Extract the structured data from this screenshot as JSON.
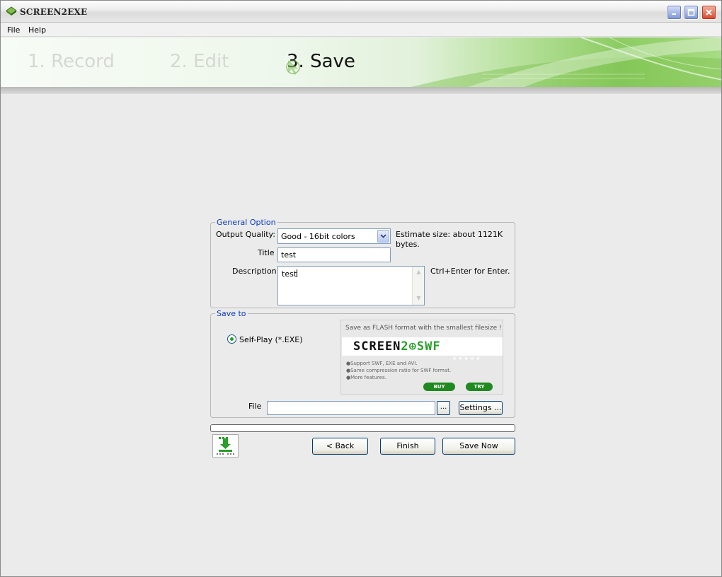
{
  "window": {
    "title": "SCREEN2EXE"
  },
  "menu": {
    "file": "File",
    "help": "Help"
  },
  "steps": {
    "record": "1. Record",
    "edit": "2. Edit",
    "save": "3. Save",
    "active": "save"
  },
  "general_option": {
    "legend": "General Option",
    "output_quality_label": "Output Quality:",
    "output_quality_value": "Good - 16bit colors",
    "estimate_line1": "Estimate size: about 1121K",
    "estimate_line2": "bytes.",
    "title_label": "Title",
    "title_value": "test",
    "description_label": "Description",
    "description_value": "test",
    "description_hint": "Ctrl+Enter for Enter."
  },
  "save_to": {
    "legend": "Save to",
    "self_play_label": "Self-Play (*.EXE)",
    "self_play_selected": true,
    "file_label": "File",
    "file_value": "",
    "browse_label": "...",
    "settings_label": "Settings ..."
  },
  "ad": {
    "headline": "Save as FLASH format with the smallest filesize !",
    "logo_left": "SCREEN",
    "logo_right": "2⊕SWF",
    "bullets": [
      "●Support SWF, EXE and AVI.",
      "●Same compression ratio for SWF format.",
      "●More features."
    ],
    "buy_label": "BUY",
    "try_label": "TRY",
    "stars": "★★★★★"
  },
  "buttons": {
    "back": "< Back",
    "finish": "Finish",
    "save_now": "Save Now"
  },
  "progress": {
    "value": 0
  },
  "colors": {
    "legend_blue": "#0b39c4",
    "accent_green": "#21a121"
  }
}
